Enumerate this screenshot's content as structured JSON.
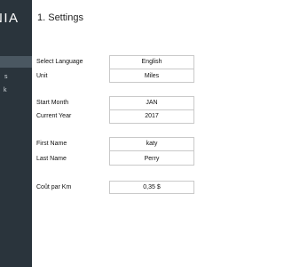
{
  "sidebar": {
    "brand_text": "NIA",
    "items": [
      {
        "label": ""
      },
      {
        "label": "s"
      },
      {
        "label": "k"
      }
    ]
  },
  "main": {
    "title": "1. Settings",
    "fields": {
      "language": {
        "label": "Select Language",
        "value": "English"
      },
      "unit": {
        "label": "Unit",
        "value": "Miles"
      },
      "start_month": {
        "label": "Start Month",
        "value": "JAN"
      },
      "current_year": {
        "label": "Current Year",
        "value": "2017"
      },
      "first_name": {
        "label": "First Name",
        "value": "katy"
      },
      "last_name": {
        "label": "Last Name",
        "value": "Perry"
      },
      "cost_per_km": {
        "label": "Coût par Km",
        "value": "0,35 $"
      }
    }
  }
}
